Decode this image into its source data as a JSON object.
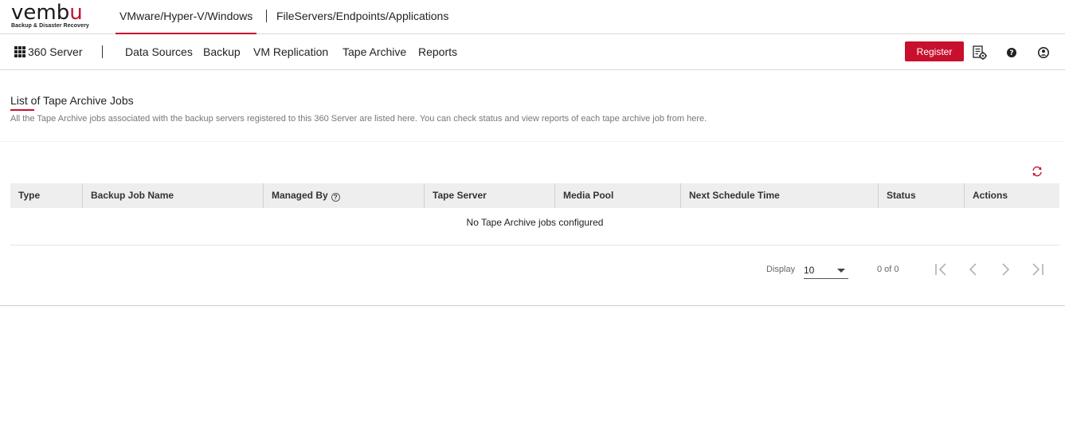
{
  "brand": {
    "logo_text": "vembu",
    "tagline": "Backup & Disaster Recovery"
  },
  "product_tabs": [
    {
      "label": "VMware/Hyper-V/Windows",
      "active": true
    },
    {
      "label": "FileServers/Endpoints/Applications",
      "active": false
    }
  ],
  "navbar": {
    "server_label": "360 Server",
    "items": [
      "Data Sources",
      "Backup",
      "VM Replication",
      "Tape Archive",
      "Reports"
    ],
    "register_label": "Register",
    "icons": [
      "settings-list-icon",
      "help-icon",
      "user-icon"
    ]
  },
  "page": {
    "title": "List of Tape Archive Jobs",
    "description": "All the Tape Archive jobs associated with the backup servers registered to this 360 Server are listed here. You can check status and view reports of each tape archive job from here."
  },
  "table": {
    "columns": [
      "Type",
      "Backup Job Name",
      "Managed By",
      "Tape Server",
      "Media Pool",
      "Next Schedule Time",
      "Status",
      "Actions"
    ],
    "empty_message": "No Tape Archive jobs configured"
  },
  "pagination": {
    "display_label": "Display",
    "page_size": "10",
    "count_text": "0 of 0"
  },
  "colors": {
    "accent": "#c8102e",
    "header_bg": "#eeeeee"
  }
}
